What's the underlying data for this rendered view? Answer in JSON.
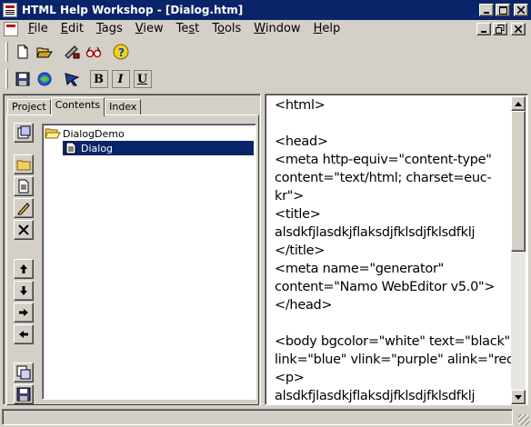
{
  "window": {
    "title": "HTML Help Workshop - [Dialog.htm]"
  },
  "menu": [
    {
      "label": "File",
      "key": "F",
      "rest": "ile"
    },
    {
      "label": "Edit",
      "key": "E",
      "rest": "dit"
    },
    {
      "label": "Tags",
      "key": "T",
      "rest": "ags"
    },
    {
      "label": "View",
      "key": "V",
      "rest": "iew"
    },
    {
      "label": "Test",
      "pre": "Te",
      "key": "s",
      "rest": "t"
    },
    {
      "label": "Tools",
      "pre": "T",
      "key": "o",
      "rest": "ols"
    },
    {
      "label": "Window",
      "key": "W",
      "rest": "indow"
    },
    {
      "label": "Help",
      "key": "H",
      "rest": "elp"
    }
  ],
  "format_buttons": {
    "bold": "B",
    "italic": "I",
    "underline": "U"
  },
  "tabs": [
    {
      "label": "Project",
      "active": false
    },
    {
      "label": "Contents",
      "active": true
    },
    {
      "label": "Index",
      "active": false
    }
  ],
  "tree": {
    "root": {
      "label": "DialogDemo",
      "icon": "folder-open-icon"
    },
    "child": {
      "label": "Dialog",
      "icon": "page-icon",
      "selected": true
    }
  },
  "editor": {
    "lines": [
      "<html>",
      "",
      "<head>",
      "<meta http-equiv=\"content-type\"",
      "content=\"text/html; charset=euc-",
      "kr\">",
      "<title>",
      "alsdkfjlasdkjflaksdjfklsdjfklsdfklj",
      "</title>",
      "<meta name=\"generator\"",
      "content=\"Namo WebEditor v5.0\">",
      "</head>",
      "",
      "<body bgcolor=\"white\" text=\"black\"",
      "link=\"blue\" vlink=\"purple\" alink=\"red\">",
      "<p>",
      "alsdkfjlasdkjflaksdjfklsdjfklsdfklj"
    ]
  },
  "colors": {
    "titlebar": "#0a246a",
    "selection": "#0a246a",
    "face": "#d4d0c8"
  }
}
